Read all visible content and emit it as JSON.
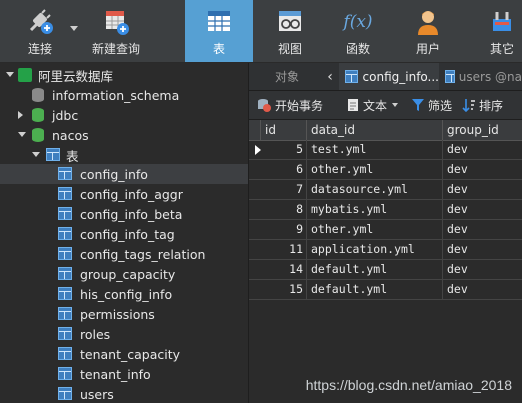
{
  "toolbar": {
    "connect_label": "连接",
    "new_query_label": "新建查询",
    "table_label": "表",
    "view_label": "视图",
    "function_label": "函数",
    "user_label": "用户",
    "other_label": "其它",
    "function_glyph": "f(x)"
  },
  "sidebar": {
    "connection": "阿里云数据库",
    "databases": [
      "information_schema",
      "jdbc",
      "nacos"
    ],
    "tables_group": "表",
    "tables": [
      "config_info",
      "config_info_aggr",
      "config_info_beta",
      "config_info_tag",
      "config_tags_relation",
      "group_capacity",
      "his_config_info",
      "permissions",
      "roles",
      "tenant_capacity",
      "tenant_info",
      "users"
    ]
  },
  "tabs": {
    "objects": "对象",
    "config_tab": "config_info...",
    "users_tab": "users @na"
  },
  "subtoolbar": {
    "begin_tx": "开始事务",
    "text": "文本",
    "filter": "筛选",
    "sort": "排序"
  },
  "grid": {
    "columns": [
      "id",
      "data_id",
      "group_id"
    ],
    "rows": [
      {
        "id": "5",
        "data_id": "test.yml",
        "group_id": "dev"
      },
      {
        "id": "6",
        "data_id": "other.yml",
        "group_id": "dev"
      },
      {
        "id": "7",
        "data_id": "datasource.yml",
        "group_id": "dev"
      },
      {
        "id": "8",
        "data_id": "mybatis.yml",
        "group_id": "dev"
      },
      {
        "id": "9",
        "data_id": "other.yml",
        "group_id": "dev"
      },
      {
        "id": "11",
        "data_id": "application.yml",
        "group_id": "dev"
      },
      {
        "id": "14",
        "data_id": "default.yml",
        "group_id": "dev"
      },
      {
        "id": "15",
        "data_id": "default.yml",
        "group_id": "dev"
      }
    ]
  },
  "watermark": "https://blog.csdn.net/amiao_2018",
  "colors": {
    "accent": "#56a0d3",
    "toolbar_bg": "#3c3f41",
    "panel_bg": "#2b2b2b",
    "db_green": "#4caf50"
  }
}
